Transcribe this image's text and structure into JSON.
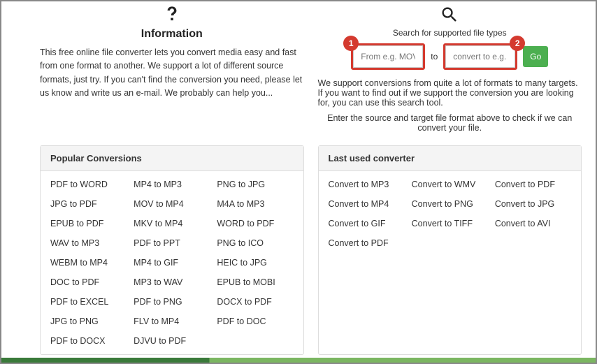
{
  "info": {
    "title": "Information",
    "desc": "This free online file converter lets you convert media easy and fast from one format to another. We support a lot of different source formats, just try. If you can't find the conversion you need, please let us know and write us an e-mail. We probably can help you..."
  },
  "search": {
    "title": "Search for supported file types",
    "from_placeholder": "From e.g. MOV",
    "to_label": "to",
    "to_placeholder": "convert to e.g. MF",
    "go_label": "Go",
    "badge1": "1",
    "badge2": "2",
    "desc1": "We support conversions from quite a lot of formats to many targets. If you want to find out if we support the conversion you are looking for, you can use this search tool.",
    "desc2": "Enter the source and target file format above to check if we can convert your file."
  },
  "popular": {
    "title": "Popular Conversions",
    "items": [
      "PDF to WORD",
      "MP4 to MP3",
      "PNG to JPG",
      "JPG to PDF",
      "MOV to MP4",
      "M4A to MP3",
      "EPUB to PDF",
      "MKV to MP4",
      "WORD to PDF",
      "WAV to MP3",
      "PDF to PPT",
      "PNG to ICO",
      "WEBM to MP4",
      "MP4 to GIF",
      "HEIC to JPG",
      "DOC to PDF",
      "MP3 to WAV",
      "EPUB to MOBI",
      "PDF to EXCEL",
      "PDF to PNG",
      "DOCX to PDF",
      "JPG to PNG",
      "FLV to MP4",
      "PDF to DOC",
      "PDF to DOCX",
      "DJVU to PDF"
    ]
  },
  "last": {
    "title": "Last used converter",
    "items": [
      "Convert to MP3",
      "Convert to WMV",
      "Convert to PDF",
      "Convert to MP4",
      "Convert to PNG",
      "Convert to JPG",
      "Convert to GIF",
      "Convert to TIFF",
      "Convert to AVI",
      "Convert to PDF"
    ]
  }
}
